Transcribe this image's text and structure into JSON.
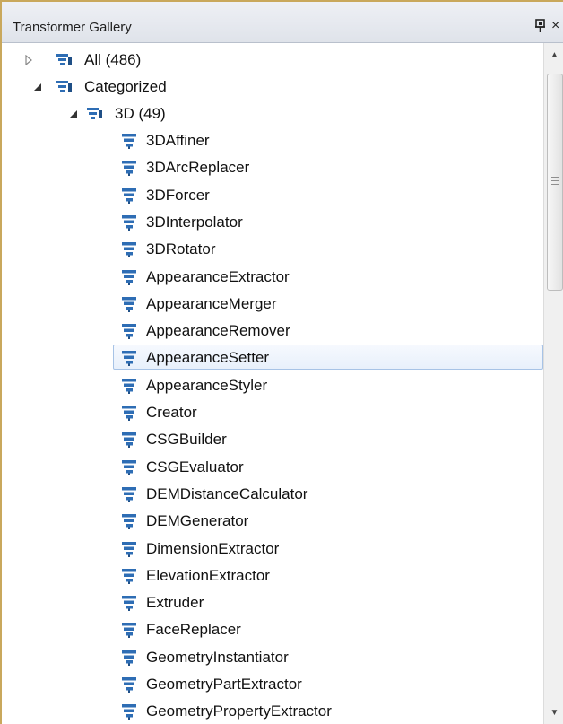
{
  "panel": {
    "title": "Transformer Gallery",
    "pin_icon": "pin-icon",
    "close_glyph": "×"
  },
  "tree": {
    "all": {
      "label": "All (486)",
      "state": "collapsed"
    },
    "categorized": {
      "label": "Categorized",
      "state": "expanded"
    },
    "category_3d": {
      "label": "3D (49)",
      "state": "expanded"
    },
    "transformers": [
      "3DAffiner",
      "3DArcReplacer",
      "3DForcer",
      "3DInterpolator",
      "3DRotator",
      "AppearanceExtractor",
      "AppearanceMerger",
      "AppearanceRemover",
      "AppearanceSetter",
      "AppearanceStyler",
      "Creator",
      "CSGBuilder",
      "CSGEvaluator",
      "DEMDistanceCalculator",
      "DEMGenerator",
      "DimensionExtractor",
      "ElevationExtractor",
      "Extruder",
      "FaceReplacer",
      "GeometryInstantiator",
      "GeometryPartExtractor",
      "GeometryPropertyExtractor"
    ],
    "selected": "AppearanceSetter"
  },
  "colors": {
    "accent_border": "#c9a85c",
    "icon_blue": "#2e6db4",
    "selection_border": "#a7c3e6"
  },
  "scrollbar": {
    "up_glyph": "▲",
    "down_glyph": "▼"
  }
}
